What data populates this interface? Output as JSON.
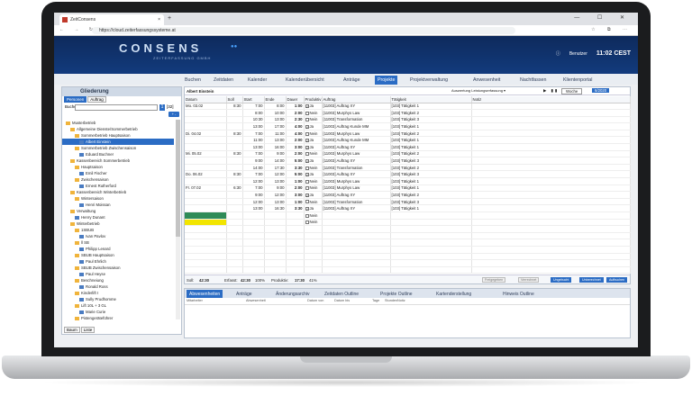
{
  "browser": {
    "tab_title": "ZeitConsens",
    "tab_close": "×",
    "new_tab": "+",
    "url": "https://cloud.zeiterfassungssysteme.at",
    "nav": "← → ↻",
    "tools": "☆ ⧉ ⋯",
    "window_controls": "— ☐ ✕"
  },
  "header": {
    "logo": "CONSENS",
    "logo_sub": "ZEITERFASSUNG GMBH",
    "user": "Benutzer",
    "time": "11:02 CEST",
    "info_icon": "ⓘ"
  },
  "menu": {
    "items": [
      "Buchen",
      "Zeitdaten",
      "Kalender",
      "Kalenderübersicht",
      "Anträge",
      "Projekte",
      "Projektverwaltung",
      "Anwesenheit",
      "Nachtfassen",
      "Klientenportal"
    ],
    "active": "Projekte"
  },
  "left": {
    "title": "Gliederung",
    "tabs": [
      "Personen",
      "Auftrag"
    ],
    "search_label": "Buchen",
    "search_button": "1",
    "search_count": "[32]",
    "add_button": "+ -",
    "footer_buttons": [
      "Baum",
      "Liste"
    ],
    "tree": [
      {
        "label": "Musterbetrieb",
        "type": "folder",
        "indent": 0
      },
      {
        "label": "Allgemeine Dienste/Sommerbetrieb",
        "type": "folder",
        "indent": 1
      },
      {
        "label": "Sommerbetrieb Hauptsaison",
        "type": "folder",
        "indent": 2
      },
      {
        "label": "Albert Einstein",
        "type": "person",
        "indent": 3,
        "selected": true
      },
      {
        "label": "Sommerbetrieb Zwischensaison",
        "type": "folder",
        "indent": 2
      },
      {
        "label": "Eduard Buchner",
        "type": "person",
        "indent": 3
      },
      {
        "label": "Kassenbereich Sommerbetrieb",
        "type": "folder",
        "indent": 1
      },
      {
        "label": "Hauptsaison",
        "type": "folder",
        "indent": 2
      },
      {
        "label": "Emil Fischer",
        "type": "person",
        "indent": 3
      },
      {
        "label": "Zwischensaison",
        "type": "folder",
        "indent": 2
      },
      {
        "label": "Ernest Rutherford",
        "type": "person",
        "indent": 3
      },
      {
        "label": "Kassenbereich Winterbetrieb",
        "type": "folder",
        "indent": 1
      },
      {
        "label": "Wintersaison",
        "type": "folder",
        "indent": 2
      },
      {
        "label": "Henri Moissan",
        "type": "person",
        "indent": 3
      },
      {
        "label": "Verwaltung",
        "type": "folder",
        "indent": 1
      },
      {
        "label": "Henry Dunant",
        "type": "person",
        "indent": 2
      },
      {
        "label": "Winterbetrieb",
        "type": "folder",
        "indent": 1
      },
      {
        "label": "1SBUB",
        "type": "folder",
        "indent": 2
      },
      {
        "label": "Ivan Pavlov",
        "type": "person",
        "indent": 3
      },
      {
        "label": "ll SB",
        "type": "folder",
        "indent": 2
      },
      {
        "label": "Philipp Lenard",
        "type": "person",
        "indent": 3
      },
      {
        "label": "SBUB Hauptsaison",
        "type": "folder",
        "indent": 2
      },
      {
        "label": "Paul Ehrlich",
        "type": "person",
        "indent": 3
      },
      {
        "label": "SBUB Zwischensaison",
        "type": "folder",
        "indent": 2
      },
      {
        "label": "Paul Heyse",
        "type": "person",
        "indent": 3
      },
      {
        "label": "Beschneiung",
        "type": "folder",
        "indent": 2
      },
      {
        "label": "Ronald Ross",
        "type": "person",
        "indent": 3
      },
      {
        "label": "Kinderlift I",
        "type": "folder",
        "indent": 2
      },
      {
        "label": "Sully Prudhomme",
        "type": "person",
        "indent": 3
      },
      {
        "label": "Lift 10L + 3 GL",
        "type": "folder",
        "indent": 2
      },
      {
        "label": "Marie Curie",
        "type": "person",
        "indent": 3
      },
      {
        "label": "Pistengeräteführer",
        "type": "folder",
        "indent": 2
      }
    ]
  },
  "main": {
    "person": "Albert Einstein",
    "report_dropdown": "Auswertung Leistungserfassung ▾",
    "controls": "▶ ▮▮",
    "period": "Woche",
    "date": "6/2020",
    "columns": [
      "Datum",
      "Soll",
      "Start",
      "Ende",
      "Dauer",
      "Produktiv",
      "Auftrag",
      "Tätigkeit",
      "Notiz"
    ],
    "rows": [
      {
        "datum": "Mo. 03.02",
        "soll": "8:30",
        "start": "7:00",
        "ende": "8:00",
        "dauer": "1:00",
        "check": true,
        "prod": "Ja",
        "auftrag": "[11003] Auftrag XY",
        "taet": "[103] Tätigkeit 1",
        "color": ""
      },
      {
        "datum": "",
        "soll": "",
        "start": "8:00",
        "ende": "10:00",
        "dauer": "2:00",
        "check": false,
        "prod": "Nein",
        "auftrag": "[11003] Murphys Law",
        "taet": "[103] Tätigkeit 2",
        "color": ""
      },
      {
        "datum": "",
        "soll": "",
        "start": "10:30",
        "ende": "13:00",
        "dauer": "2:30",
        "check": false,
        "prod": "Nein",
        "auftrag": "[11003] Transformation",
        "taet": "[103] Tätigkeit 3",
        "color": ""
      },
      {
        "datum": "",
        "soll": "",
        "start": "13:00",
        "ende": "17:00",
        "dauer": "4:00",
        "check": true,
        "prod": "Ja",
        "auftrag": "[11003] Auftrag Kunde MM",
        "taet": "[103] Tätigkeit 1",
        "color": ""
      },
      {
        "datum": "Di. 04.02",
        "soll": "8:30",
        "start": "7:00",
        "ende": "11:00",
        "dauer": "4:00",
        "check": false,
        "prod": "Nein",
        "auftrag": "[11003] Murphys Law",
        "taet": "[103] Tätigkeit 2",
        "color": ""
      },
      {
        "datum": "",
        "soll": "",
        "start": "11:00",
        "ende": "13:00",
        "dauer": "2:00",
        "check": true,
        "prod": "Ja",
        "auftrag": "[11003] Auftrag Kunde MM",
        "taet": "[103] Tätigkeit 1",
        "color": ""
      },
      {
        "datum": "",
        "soll": "",
        "start": "13:00",
        "ende": "16:00",
        "dauer": "3:00",
        "check": true,
        "prod": "Ja",
        "auftrag": "[11003] Auftrag XY",
        "taet": "[103] Tätigkeit 1",
        "color": ""
      },
      {
        "datum": "Mi. 05.02",
        "soll": "8:30",
        "start": "7:00",
        "ende": "9:00",
        "dauer": "2:00",
        "check": false,
        "prod": "Nein",
        "auftrag": "[11003] Murphys Law",
        "taet": "[103] Tätigkeit 2",
        "color": ""
      },
      {
        "datum": "",
        "soll": "",
        "start": "9:00",
        "ende": "14:00",
        "dauer": "5:00",
        "check": true,
        "prod": "Ja",
        "auftrag": "[11003] Auftrag XY",
        "taet": "[103] Tätigkeit 3",
        "color": ""
      },
      {
        "datum": "",
        "soll": "",
        "start": "14:00",
        "ende": "17:30",
        "dauer": "3:30",
        "check": false,
        "prod": "Nein",
        "auftrag": "[11003] Transformation",
        "taet": "[103] Tätigkeit 2",
        "color": ""
      },
      {
        "datum": "Do. 06.02",
        "soll": "8:30",
        "start": "7:00",
        "ende": "12:00",
        "dauer": "5:00",
        "check": true,
        "prod": "Ja",
        "auftrag": "[11003] Auftrag XY",
        "taet": "[103] Tätigkeit 3",
        "color": ""
      },
      {
        "datum": "",
        "soll": "",
        "start": "12:00",
        "ende": "13:00",
        "dauer": "1:00",
        "check": false,
        "prod": "Nein",
        "auftrag": "[11003] Murphys Law",
        "taet": "[103] Tätigkeit 1",
        "color": ""
      },
      {
        "datum": "Fr. 07.02",
        "soll": "6:30",
        "start": "7:00",
        "ende": "9:00",
        "dauer": "2:00",
        "check": false,
        "prod": "Nein",
        "auftrag": "[11003] Murphys Law",
        "taet": "[103] Tätigkeit 1",
        "color": ""
      },
      {
        "datum": "",
        "soll": "",
        "start": "9:00",
        "ende": "12:00",
        "dauer": "3:00",
        "check": true,
        "prod": "Ja",
        "auftrag": "[11003] Auftrag XY",
        "taet": "[103] Tätigkeit 2",
        "color": ""
      },
      {
        "datum": "",
        "soll": "",
        "start": "12:00",
        "ende": "13:00",
        "dauer": "1:00",
        "check": false,
        "prod": "Nein",
        "auftrag": "[11003] Transformation",
        "taet": "[103] Tätigkeit 3",
        "color": ""
      },
      {
        "datum": "",
        "soll": "",
        "start": "13:00",
        "ende": "16:30",
        "dauer": "3:30",
        "check": true,
        "prod": "Ja",
        "auftrag": "[11003] Auftrag XY",
        "taet": "[103] Tätigkeit 1",
        "color": ""
      },
      {
        "datum": "",
        "soll": "",
        "start": "",
        "ende": "",
        "dauer": "",
        "check": false,
        "prod": "Nein",
        "auftrag": "",
        "taet": "",
        "color": "#2e8b57"
      },
      {
        "datum": "",
        "soll": "",
        "start": "",
        "ende": "",
        "dauer": "",
        "check": false,
        "prod": "Nein",
        "auftrag": "",
        "taet": "",
        "color": "#f2e500"
      },
      {
        "datum": "",
        "soll": "",
        "start": "",
        "ende": "",
        "dauer": "",
        "check": false,
        "prod": "",
        "auftrag": "",
        "taet": "",
        "color": ""
      },
      {
        "datum": "",
        "soll": "",
        "start": "",
        "ende": "",
        "dauer": "",
        "check": false,
        "prod": "",
        "auftrag": "",
        "taet": "",
        "color": ""
      },
      {
        "datum": "",
        "soll": "",
        "start": "",
        "ende": "",
        "dauer": "",
        "check": false,
        "prod": "",
        "auftrag": "",
        "taet": "",
        "color": ""
      },
      {
        "datum": "",
        "soll": "",
        "start": "",
        "ende": "",
        "dauer": "",
        "check": false,
        "prod": "",
        "auftrag": "",
        "taet": "",
        "color": ""
      },
      {
        "datum": "",
        "soll": "",
        "start": "",
        "ende": "",
        "dauer": "",
        "check": false,
        "prod": "",
        "auftrag": "",
        "taet": "",
        "color": ""
      },
      {
        "datum": "",
        "soll": "",
        "start": "",
        "ende": "",
        "dauer": "",
        "check": false,
        "prod": "",
        "auftrag": "",
        "taet": "",
        "color": ""
      },
      {
        "datum": "",
        "soll": "",
        "start": "",
        "ende": "",
        "dauer": "",
        "check": false,
        "prod": "",
        "auftrag": "",
        "taet": "",
        "color": ""
      }
    ],
    "footer": {
      "soll_label": "Soll:",
      "soll_value": "42:30",
      "erfasst_label": "Erfasst:",
      "erfasst_value": "42:30",
      "erfasst_pct": "100%",
      "produktiv_label": "Produktiv:",
      "produktiv_value": "17:30",
      "produktiv_pct": "41%",
      "buttons": [
        "Freigegeben",
        "Verrechnet",
        "Ungebucht",
        "Unberechnet",
        "Aufbuchen"
      ]
    }
  },
  "bottom": {
    "tabs": [
      "Abwesenheiten",
      "Anträge",
      "Änderungsarchiv",
      "Zeitdaten Outline",
      "Projekte Outline",
      "Kartenderstellung",
      "Hinweis Outline"
    ],
    "active": "Abwesenheiten",
    "columns": [
      "Mitarbeiter",
      "Abwesenheit",
      "Datum von",
      "Datum bis",
      "Tage",
      "Stunden",
      "Notiz"
    ]
  },
  "colors": {
    "brand_dark": "#0e2a5c",
    "accent": "#2b6cc4",
    "green": "#2e8b57",
    "yellow": "#f2e500"
  }
}
